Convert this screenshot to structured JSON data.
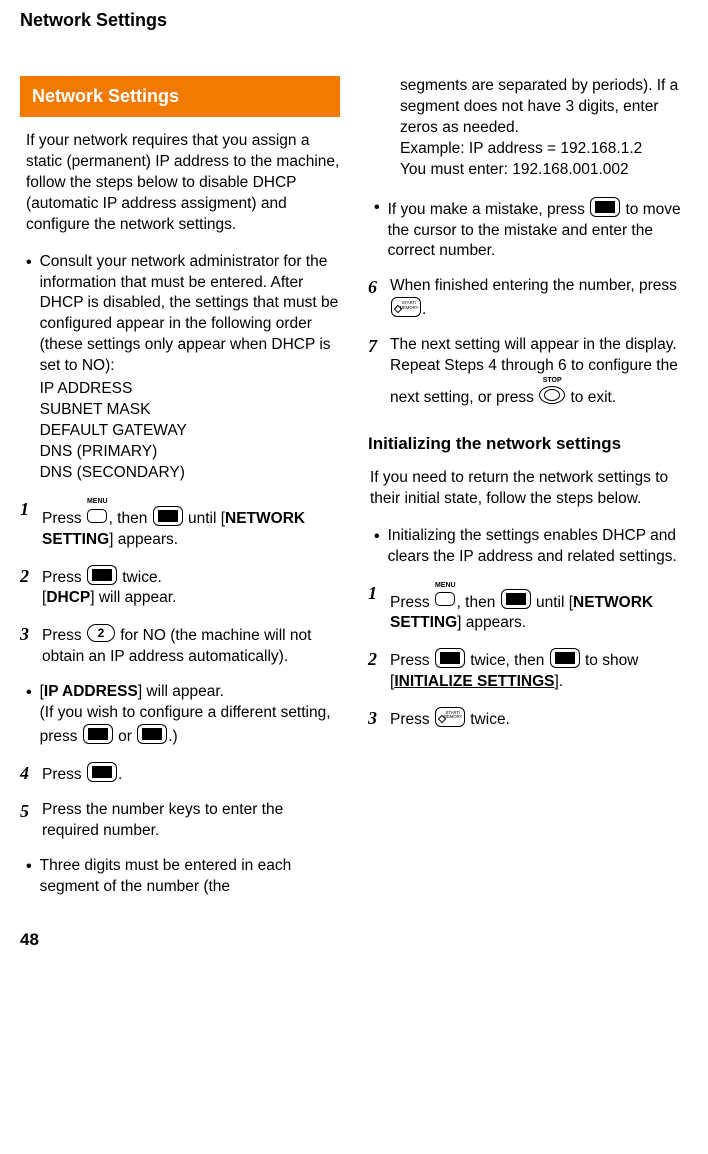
{
  "header": "Network Settings",
  "page_number": "48",
  "left": {
    "section_title": "Network Settings",
    "intro": "If your network requires that you assign a static (permanent) IP address to the machine, follow the steps below to disable DHCP (automatic IP address assigment) and configure the network settings.",
    "bullet1_pre": "Consult your network administrator for the information that must be entered. After DHCP is disabled, the settings that must be configured appear in the following order (these settings only appear when DHCP is set to NO):",
    "settings_list": [
      "IP ADDRESS",
      "SUBNET MASK",
      "DEFAULT GATEWAY",
      "DNS (PRIMARY)",
      "DNS (SECONDARY)"
    ],
    "icon_labels": {
      "menu": "MENU",
      "stop": "STOP"
    },
    "step1": {
      "n": "1",
      "a": "Press ",
      "b": ", then ",
      "c": " until [",
      "term": "NETWORK SETTING",
      "d": "] appears."
    },
    "step2": {
      "n": "2",
      "a": "Press ",
      "b": " twice.",
      "c": "[",
      "term": "DHCP",
      "d": "] will appear."
    },
    "step3": {
      "n": "3",
      "a": "Press ",
      "num": "2",
      "b": " for NO (the machine will not obtain an IP address automatically)."
    },
    "bullet2": {
      "a": "[",
      "term": "IP ADDRESS",
      "b": "] will appear.",
      "c": "(If you wish to configure a different setting, press ",
      "d": " or ",
      "e": ".)"
    },
    "step4": {
      "n": "4",
      "a": "Press ",
      "b": "."
    },
    "step5": {
      "n": "5",
      "a": "Press the number keys to enter the required number."
    },
    "bullet3": "Three digits must be entered in each segment of the number (the"
  },
  "right": {
    "cont1": "segments are separated by periods). If a segment does not have 3 digits, enter zeros as needed.",
    "cont2a": "Example: IP address = 192.168.1.2",
    "cont2b": "You must enter: 192.168.001.002",
    "bullet1": {
      "a": "If you make a mistake, press ",
      "b": " to move the cursor to the mistake and enter the correct number."
    },
    "step6": {
      "n": "6",
      "a": "When finished entering the number, press ",
      "b": "."
    },
    "step7": {
      "n": "7",
      "a": "The next setting will appear in the display. Repeat Steps 4 through 6 to configure the next setting, or press ",
      "b": " to exit."
    },
    "sub_title": "Initializing the network settings",
    "init_intro": "If you need to return the network settings to their initial state, follow the steps below.",
    "bullet2": "Initializing the settings enables DHCP and clears the IP address and related settings.",
    "step1": {
      "n": "1",
      "a": "Press ",
      "b": ", then ",
      "c": " until [",
      "term": "NETWORK SETTING",
      "d": "] appears."
    },
    "step2": {
      "n": "2",
      "a": "Press ",
      "b": " twice, then ",
      "c": " to show [",
      "term": "INITIALIZE SETTINGS",
      "d": "]."
    },
    "step3": {
      "n": "3",
      "a": "Press ",
      "b": " twice."
    }
  }
}
